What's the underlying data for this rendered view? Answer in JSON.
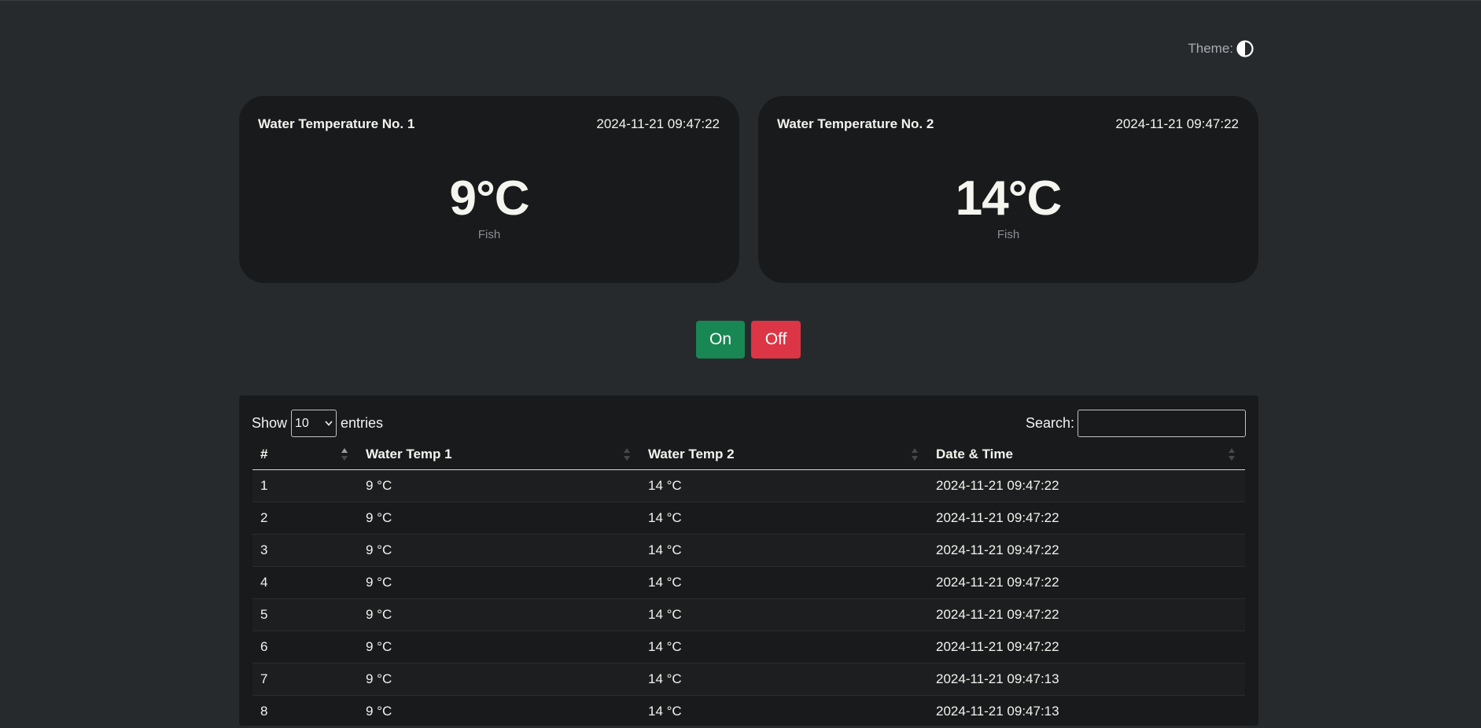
{
  "theme": {
    "label": "Theme:",
    "icon": "contrast-icon"
  },
  "cards": [
    {
      "title": "Water Temperature No. 1",
      "timestamp": "2024-11-21 09:47:22",
      "value": "9°C",
      "label": "Fish"
    },
    {
      "title": "Water Temperature No. 2",
      "timestamp": "2024-11-21 09:47:22",
      "value": "14°C",
      "label": "Fish"
    }
  ],
  "controls": {
    "on_label": "On",
    "off_label": "Off",
    "on_color": "#198754",
    "off_color": "#dc3545"
  },
  "table": {
    "show_label": "Show",
    "entries_label": "entries",
    "page_length": "10",
    "search_label": "Search:",
    "search_value": "",
    "columns": [
      "#",
      "Water Temp 1",
      "Water Temp 2",
      "Date & Time"
    ],
    "rows": [
      [
        "1",
        "9 °C",
        "14 °C",
        "2024-11-21 09:47:22"
      ],
      [
        "2",
        "9 °C",
        "14 °C",
        "2024-11-21 09:47:22"
      ],
      [
        "3",
        "9 °C",
        "14 °C",
        "2024-11-21 09:47:22"
      ],
      [
        "4",
        "9 °C",
        "14 °C",
        "2024-11-21 09:47:22"
      ],
      [
        "5",
        "9 °C",
        "14 °C",
        "2024-11-21 09:47:22"
      ],
      [
        "6",
        "9 °C",
        "14 °C",
        "2024-11-21 09:47:22"
      ],
      [
        "7",
        "9 °C",
        "14 °C",
        "2024-11-21 09:47:13"
      ],
      [
        "8",
        "9 °C",
        "14 °C",
        "2024-11-21 09:47:13"
      ]
    ]
  }
}
